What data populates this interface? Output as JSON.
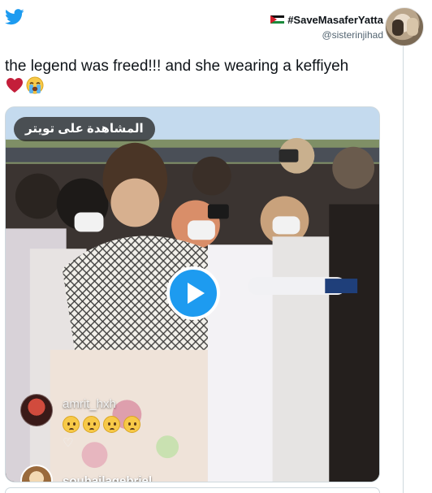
{
  "header": {
    "display_name": "#SaveMasaferYatta",
    "handle": "@sisterinjihad"
  },
  "tweet": {
    "text": "the legend was freed!!! and she wearing a keffiyeh"
  },
  "media": {
    "watch_label": "المشاهدة على تويتر"
  },
  "comments": [
    {
      "username": "amrit_hxh"
    },
    {
      "username": "souhailagebriel"
    }
  ],
  "colors": {
    "twitter_blue": "#1d9bf0",
    "text": "#0f1419",
    "secondary_text": "#536471",
    "border": "#cfd9de"
  },
  "icons": {
    "logo": "twitter-bird-icon",
    "play": "play-icon",
    "emoji_heart": "red-heart-icon",
    "emoji_cry": "loudly-crying-face-icon",
    "emoji_plead": "pleading-face-icon",
    "heart_outline": "heart-outline-icon"
  }
}
